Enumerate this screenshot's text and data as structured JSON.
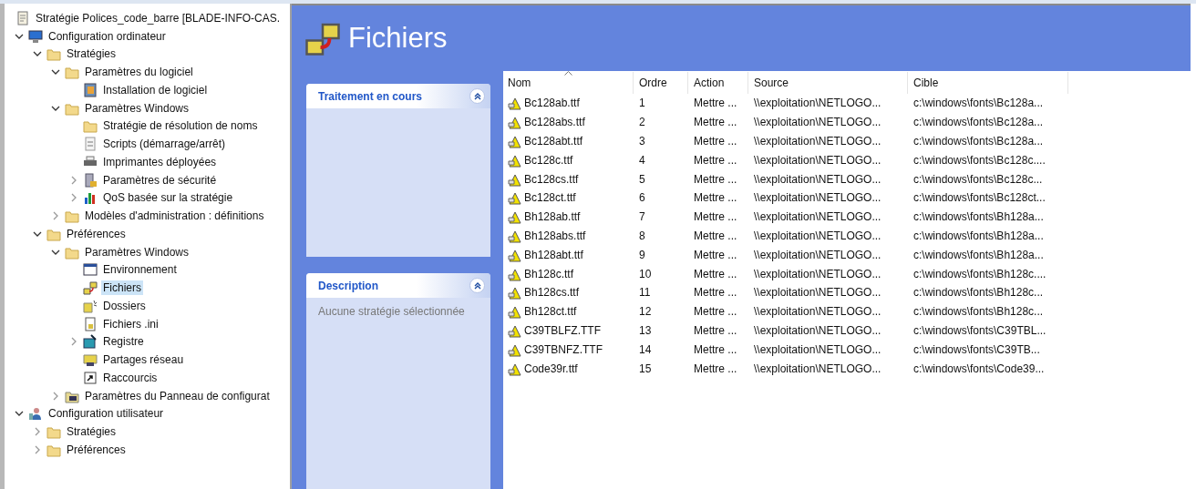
{
  "tree": [
    {
      "label": "Stratégie Polices_code_barre [BLADE-INFO-CAS.",
      "selected": false,
      "children": [
        {
          "label": "Configuration ordinateur",
          "expanded": true,
          "selected": false,
          "children": [
            {
              "label": "Stratégies",
              "expanded": true,
              "selected": false,
              "children": [
                {
                  "label": "Paramètres du logiciel",
                  "expanded": true,
                  "selected": false,
                  "children": [
                    {
                      "label": "Installation de logiciel",
                      "selected": false
                    }
                  ]
                },
                {
                  "label": "Paramètres Windows",
                  "expanded": true,
                  "selected": false,
                  "children": [
                    {
                      "label": "Stratégie de résolution de noms",
                      "selected": false
                    },
                    {
                      "label": "Scripts (démarrage/arrêt)",
                      "selected": false
                    },
                    {
                      "label": "Imprimantes déployées",
                      "selected": false
                    },
                    {
                      "label": "Paramètres de sécurité",
                      "expanded": false,
                      "selected": false
                    },
                    {
                      "label": "QoS basée sur la stratégie",
                      "expanded": false,
                      "selected": false
                    }
                  ]
                },
                {
                  "label": "Modèles d'administration : définitions",
                  "expanded": false,
                  "selected": false
                }
              ]
            },
            {
              "label": "Préférences",
              "expanded": true,
              "selected": false,
              "children": [
                {
                  "label": "Paramètres Windows",
                  "expanded": true,
                  "selected": false,
                  "children": [
                    {
                      "label": "Environnement",
                      "selected": false
                    },
                    {
                      "label": "Fichiers",
                      "selected": true
                    },
                    {
                      "label": "Dossiers",
                      "selected": false
                    },
                    {
                      "label": "Fichiers .ini",
                      "selected": false
                    },
                    {
                      "label": "Registre",
                      "expanded": false,
                      "selected": false
                    },
                    {
                      "label": "Partages réseau",
                      "selected": false
                    },
                    {
                      "label": "Raccourcis",
                      "selected": false
                    }
                  ]
                },
                {
                  "label": "Paramètres du Panneau de configurat",
                  "expanded": false,
                  "selected": false
                }
              ]
            }
          ]
        },
        {
          "label": "Configuration utilisateur",
          "expanded": true,
          "selected": false,
          "children": [
            {
              "label": "Stratégies",
              "expanded": false,
              "selected": false
            },
            {
              "label": "Préférences",
              "expanded": false,
              "selected": false
            }
          ]
        }
      ]
    }
  ],
  "header": {
    "title": "Fichiers"
  },
  "panels": [
    {
      "title": "Traitement en cours",
      "expanded": true
    },
    {
      "title": "Description",
      "expanded": true,
      "text": "Aucune stratégie sélectionnée"
    }
  ],
  "table": {
    "columns": [
      "Nom",
      "Ordre",
      "Action",
      "Source",
      "Cible"
    ],
    "rows": [
      [
        "Bc128ab.ttf",
        "1",
        "Mettre ...",
        "\\\\exploitation\\NETLOGO...",
        "c:\\windows\\fonts\\Bc128a..."
      ],
      [
        "Bc128abs.ttf",
        "2",
        "Mettre ...",
        "\\\\exploitation\\NETLOGO...",
        "c:\\windows\\fonts\\Bc128a..."
      ],
      [
        "Bc128abt.ttf",
        "3",
        "Mettre ...",
        "\\\\exploitation\\NETLOGO...",
        "c:\\windows\\fonts\\Bc128a..."
      ],
      [
        "Bc128c.ttf",
        "4",
        "Mettre ...",
        "\\\\exploitation\\NETLOGO...",
        "c:\\windows\\fonts\\Bc128c...."
      ],
      [
        "Bc128cs.ttf",
        "5",
        "Mettre ...",
        "\\\\exploitation\\NETLOGO...",
        "c:\\windows\\fonts\\Bc128c..."
      ],
      [
        "Bc128ct.ttf",
        "6",
        "Mettre ...",
        "\\\\exploitation\\NETLOGO...",
        "c:\\windows\\fonts\\Bc128ct..."
      ],
      [
        "Bh128ab.ttf",
        "7",
        "Mettre ...",
        "\\\\exploitation\\NETLOGO...",
        "c:\\windows\\fonts\\Bh128a..."
      ],
      [
        "Bh128abs.ttf",
        "8",
        "Mettre ...",
        "\\\\exploitation\\NETLOGO...",
        "c:\\windows\\fonts\\Bh128a..."
      ],
      [
        "Bh128abt.ttf",
        "9",
        "Mettre ...",
        "\\\\exploitation\\NETLOGO...",
        "c:\\windows\\fonts\\Bh128a..."
      ],
      [
        "Bh128c.ttf",
        "10",
        "Mettre ...",
        "\\\\exploitation\\NETLOGO...",
        "c:\\windows\\fonts\\Bh128c...."
      ],
      [
        "Bh128cs.ttf",
        "11",
        "Mettre ...",
        "\\\\exploitation\\NETLOGO...",
        "c:\\windows\\fonts\\Bh128c..."
      ],
      [
        "Bh128ct.ttf",
        "12",
        "Mettre ...",
        "\\\\exploitation\\NETLOGO...",
        "c:\\windows\\fonts\\Bh128c..."
      ],
      [
        "C39TBLFZ.TTF",
        "13",
        "Mettre ...",
        "\\\\exploitation\\NETLOGO...",
        "c:\\windows\\fonts\\C39TBL..."
      ],
      [
        "C39TBNFZ.TTF",
        "14",
        "Mettre ...",
        "\\\\exploitation\\NETLOGO...",
        "c:\\windows\\fonts\\C39TB..."
      ],
      [
        "Code39r.ttf",
        "15",
        "Mettre ...",
        "\\\\exploitation\\NETLOGO...",
        "c:\\windows\\fonts\\Code39..."
      ]
    ]
  }
}
